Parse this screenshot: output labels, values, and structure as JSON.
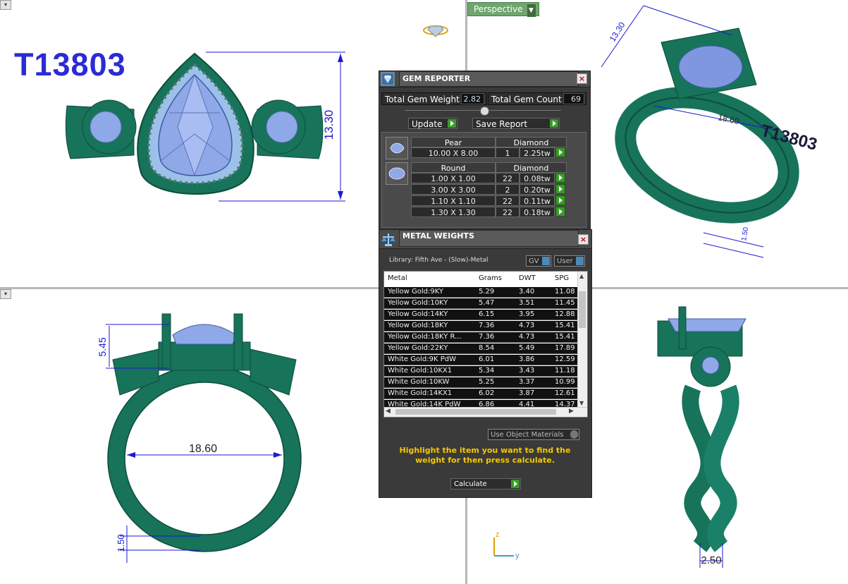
{
  "viewport": {
    "mode_label": "Perspective",
    "model_code": "T13803",
    "dims_top_left": {
      "height": "13.30"
    },
    "dims_top_right": {
      "a": "13.30",
      "b": "18.60",
      "c": "1.50"
    },
    "dims_bottom_left": {
      "a": "5.45",
      "b": "18.60",
      "c": "1.50"
    },
    "dims_bottom_right": {
      "a": "2.50"
    },
    "axis": {
      "z": "z",
      "y": "y"
    }
  },
  "gem_reporter": {
    "title": "GEM REPORTER",
    "total_weight_label": "Total Gem Weight",
    "total_weight_value": "2.82",
    "total_count_label": "Total Gem Count",
    "total_count_value": "69",
    "update_label": "Update",
    "save_label": "Save Report",
    "groups": [
      {
        "shape": "Pear",
        "material": "Diamond",
        "rows": [
          {
            "size": "10.00 X 8.00",
            "count": "1",
            "weight": "2.25tw"
          }
        ]
      },
      {
        "shape": "Round",
        "material": "Diamond",
        "rows": [
          {
            "size": "1.00 X 1.00",
            "count": "22",
            "weight": "0.08tw"
          },
          {
            "size": "3.00 X 3.00",
            "count": "2",
            "weight": "0.20tw"
          },
          {
            "size": "1.10 X 1.10",
            "count": "22",
            "weight": "0.11tw"
          },
          {
            "size": "1.30 X 1.30",
            "count": "22",
            "weight": "0.18tw"
          }
        ]
      }
    ]
  },
  "metal_weights": {
    "title": "METAL WEIGHTS",
    "library": "Library: Fifth Ave - (Slow)-Metal",
    "gv_label": "GV",
    "user_label": "User",
    "columns": [
      "Metal",
      "Grams",
      "DWT",
      "SPG"
    ],
    "rows": [
      [
        "Yellow Gold:9KY",
        "5.29",
        "3.40",
        "11.08"
      ],
      [
        "Yellow Gold:10KY",
        "5.47",
        "3.51",
        "11.45"
      ],
      [
        "Yellow Gold:14KY",
        "6.15",
        "3.95",
        "12.88"
      ],
      [
        "Yellow Gold:18KY",
        "7.36",
        "4.73",
        "15.41"
      ],
      [
        "Yellow Gold:18KY R...",
        "7.36",
        "4.73",
        "15.41"
      ],
      [
        "Yellow Gold:22KY",
        "8.54",
        "5.49",
        "17.89"
      ],
      [
        "White Gold:9K PdW",
        "6.01",
        "3.86",
        "12.59"
      ],
      [
        "White Gold:10KX1",
        "5.34",
        "3.43",
        "11.18"
      ],
      [
        "White Gold:10KW",
        "5.25",
        "3.37",
        "10.99"
      ],
      [
        "White Gold:14KX1",
        "6.02",
        "3.87",
        "12.61"
      ],
      [
        "White Gold:14K PdW",
        "6.86",
        "4.41",
        "14.37"
      ]
    ],
    "use_object_materials": "Use Object Materials",
    "hint": "Highlight the item you want to find the weight for then press calculate.",
    "calculate_label": "Calculate"
  },
  "colors": {
    "ring_green": "#17735a",
    "ring_dark": "#0c4d3b",
    "gem_blue": "#8fa8e8",
    "dim_blue": "#1a1ad0",
    "title_blue": "#2b2bd6"
  }
}
